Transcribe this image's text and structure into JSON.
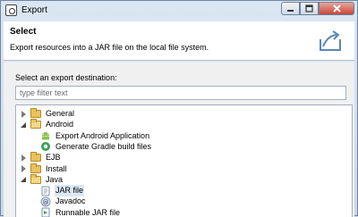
{
  "window": {
    "title": "Export"
  },
  "banner": {
    "title": "Select",
    "description": "Export resources into a JAR file on the local file system."
  },
  "destination": {
    "label": "Select an export destination:",
    "filter_placeholder": "type filter text"
  },
  "tree": [
    {
      "label": "General",
      "type": "folder",
      "expanded": false
    },
    {
      "label": "Android",
      "type": "folder",
      "expanded": true
    },
    {
      "label": "Export Android Application",
      "type": "leaf",
      "icon": "android-icon"
    },
    {
      "label": "Generate Gradle build files",
      "type": "leaf",
      "icon": "gradle-icon"
    },
    {
      "label": "EJB",
      "type": "folder",
      "expanded": false
    },
    {
      "label": "Install",
      "type": "folder",
      "expanded": false
    },
    {
      "label": "Java",
      "type": "folder",
      "expanded": true
    },
    {
      "label": "JAR file",
      "type": "leaf",
      "icon": "jar-icon",
      "selected": true
    },
    {
      "label": "Javadoc",
      "type": "leaf",
      "icon": "javadoc-icon"
    },
    {
      "label": "Runnable JAR file",
      "type": "leaf",
      "icon": "runnable-jar-icon"
    }
  ],
  "colors": {
    "selection": "#dbe7f5",
    "folder": "#e9c259",
    "android": "#8bc34a"
  }
}
